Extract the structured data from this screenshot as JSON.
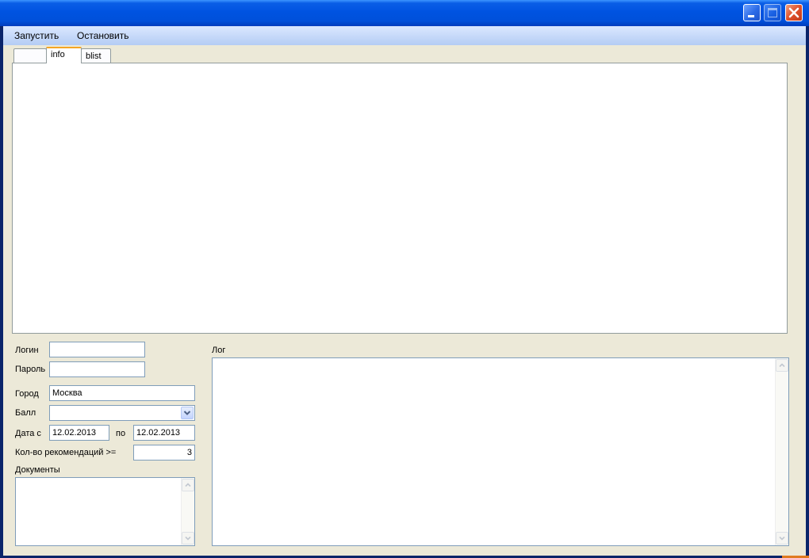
{
  "window": {
    "title": ""
  },
  "menu": {
    "items": [
      {
        "label": "Запустить"
      },
      {
        "label": "Остановить"
      }
    ]
  },
  "tabs": [
    {
      "label": ""
    },
    {
      "label": "info"
    },
    {
      "label": "blist"
    }
  ],
  "form": {
    "login_label": "Логин",
    "login_value": "",
    "password_label": "Пароль",
    "password_value": "",
    "city_label": "Город",
    "city_value": "Москва",
    "score_label": "Балл",
    "score_value": "",
    "date_from_label": "Дата с",
    "date_from_value": "12.02.2013",
    "date_to_label": "по",
    "date_to_value": "12.02.2013",
    "recommendations_label": "Кол-во рекомендаций >=",
    "recommendations_value": "3",
    "documents_label": "Документы",
    "documents_value": ""
  },
  "log": {
    "label": "Лог",
    "value": ""
  },
  "icons": {
    "minimize": "minimize-icon",
    "maximize": "maximize-icon",
    "close": "close-icon",
    "dropdown": "chevron-down-icon",
    "scroll_up": "scroll-up-icon",
    "scroll_down": "scroll-down-icon"
  }
}
